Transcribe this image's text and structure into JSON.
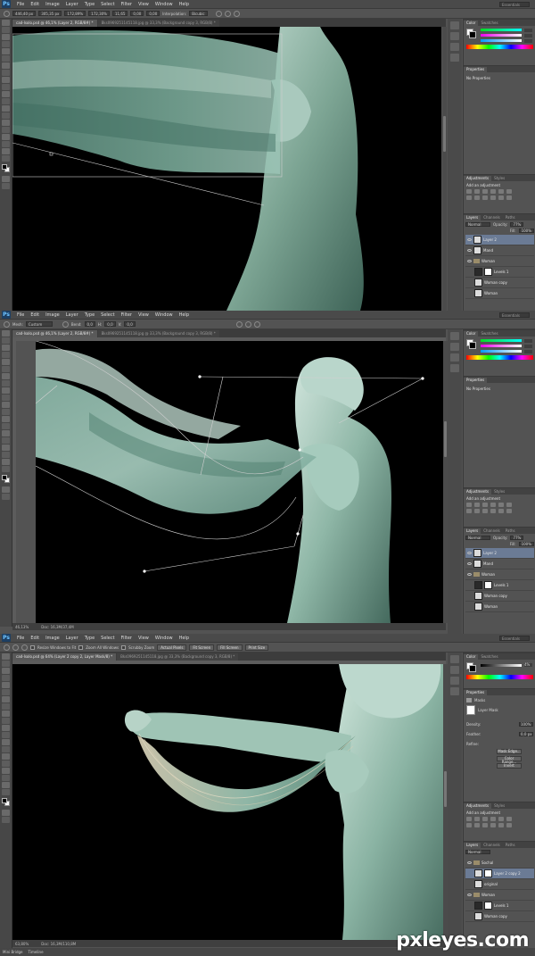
{
  "app": {
    "logo": "Ps",
    "menu": [
      "File",
      "Edit",
      "Image",
      "Layer",
      "Type",
      "Select",
      "Filter",
      "View",
      "Window",
      "Help"
    ],
    "workspace": "Essentials"
  },
  "shot1": {
    "options": {
      "fields": [
        "446,40 px",
        "305,35 px",
        "172,89%",
        "172,30%",
        "11,65"
      ],
      "angle": "0,00",
      "skew": "0,00",
      "interpolation_label": "Interpolation:",
      "interpolation_value": "Bicubic"
    },
    "tabs": [
      "cad-Isolo.psd @ 46,1% (Layer 2, RGB/8#) *",
      "Bks0969251145118.jpg @ 33,3% (Background copy 3, RGB/8) *"
    ],
    "panels": {
      "color_tabs": [
        "Color",
        "Swatches"
      ],
      "properties_title": "Properties",
      "properties_text": "No Properties",
      "adjustments_tabs": [
        "Adjustments",
        "Styles"
      ],
      "adjustments_title": "Add an adjustment",
      "layers_tabs": [
        "Layers",
        "Channels",
        "Paths"
      ],
      "blend_mode": "Normal",
      "opacity_label": "Opacity:",
      "opacity": "77%",
      "fill_label": "Fill:",
      "fill": "100%",
      "layers": [
        {
          "name": "Layer 2",
          "selected": true,
          "type": "pixel"
        },
        {
          "name": "Mand",
          "selected": false,
          "type": "pixel"
        },
        {
          "name": "Woman",
          "selected": false,
          "type": "group"
        },
        {
          "name": "Levels 1",
          "selected": false,
          "type": "adjust"
        },
        {
          "name": "Woman copy",
          "selected": false,
          "type": "pixel"
        },
        {
          "name": "Woman",
          "selected": false,
          "type": "pixel"
        }
      ]
    }
  },
  "shot2": {
    "options": {
      "mesh_label": "Mesh:",
      "mesh_value": "Custom",
      "bend_label": "Bend:",
      "bend_value": "0,0",
      "h_label": "H:",
      "h_value": "0,0",
      "v_label": "V:",
      "v_value": "0,0"
    },
    "tabs": [
      "cad-Isolo.psd @ 46,1% (Layer 2, RGB/8#) *",
      "Bks0969251145118.jpg @ 33,3% (Background copy 3, RGB/8) *"
    ],
    "status": {
      "zoom": "46,13%",
      "doc": "Doc: 16,3M/37,4M"
    },
    "panels": {
      "color_tabs": [
        "Color",
        "Swatches"
      ],
      "properties_title": "Properties",
      "properties_text": "No Properties",
      "adjustments_tabs": [
        "Adjustments",
        "Styles"
      ],
      "adjustments_title": "Add an adjustment",
      "layers_tabs": [
        "Layers",
        "Channels",
        "Paths"
      ],
      "blend_mode": "Normal",
      "opacity_label": "Opacity:",
      "opacity": "77%",
      "fill_label": "Fill:",
      "fill": "100%",
      "layers": [
        {
          "name": "Layer 2",
          "selected": true,
          "type": "pixel"
        },
        {
          "name": "Mand",
          "selected": false,
          "type": "pixel"
        },
        {
          "name": "Woman",
          "selected": false,
          "type": "group"
        },
        {
          "name": "Levels 1",
          "selected": false,
          "type": "adjust"
        },
        {
          "name": "Woman copy",
          "selected": false,
          "type": "pixel"
        },
        {
          "name": "Woman",
          "selected": false,
          "type": "pixel"
        }
      ]
    }
  },
  "shot3": {
    "options": {
      "resize_windows": "Resize Windows to Fit",
      "zoom_all": "Zoom All Windows",
      "scrubby": "Scrubby Zoom",
      "actual_pixels": "Actual Pixels",
      "fit_screen": "Fit Screen",
      "fill_screen": "Fill Screen",
      "print_size": "Print Size"
    },
    "tabs": [
      "cad-Isolo.psd @ 64% (Layer 2 copy 2, Layer Mask/8) *",
      "Bks0969251145118.jpg @ 33,3% (Background copy 3, RGB/8) *"
    ],
    "status": {
      "zoom": "63,80%",
      "doc": "Doc: 16,3M/110,8M"
    },
    "panels": {
      "color_tabs": [
        "Color",
        "Swatches"
      ],
      "color_value": "4%",
      "properties_title": "Properties",
      "masks_title": "Masks",
      "layer_mask": "Layer Mask",
      "density_label": "Density:",
      "density": "100%",
      "feather_label": "Feather:",
      "feather": "0,0 px",
      "refine_label": "Refine:",
      "mask_edge": "Mask Edge...",
      "color_range": "Color Range...",
      "invert": "Invert",
      "adjustments_tabs": [
        "Adjustments",
        "Styles"
      ],
      "adjustments_title": "Add an adjustment",
      "layers_tabs": [
        "Layers",
        "Channels",
        "Paths"
      ],
      "blend_mode": "Normal",
      "layers": [
        {
          "name": "Sochal",
          "selected": false,
          "type": "group"
        },
        {
          "name": "Layer 2 copy 2",
          "selected": true,
          "type": "masked"
        },
        {
          "name": "original",
          "selected": false,
          "type": "pixel"
        },
        {
          "name": "Woman",
          "selected": false,
          "type": "group"
        },
        {
          "name": "Levels 1",
          "selected": false,
          "type": "adjust"
        },
        {
          "name": "Woman copy",
          "selected": false,
          "type": "pixel"
        }
      ]
    },
    "bottom_tabs": [
      "Mini Bridge",
      "Timeline"
    ]
  },
  "watermark": "pxleyes.com"
}
